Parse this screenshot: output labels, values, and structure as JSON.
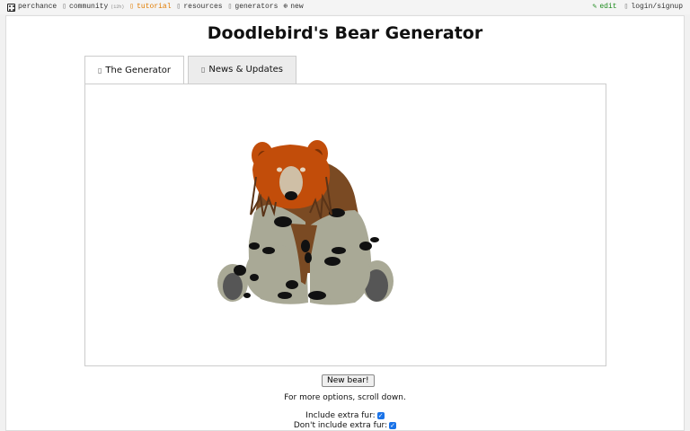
{
  "nav": {
    "brand": "perchance",
    "links": [
      {
        "label": "community",
        "count": "(12h)"
      },
      {
        "label": "tutorial"
      },
      {
        "label": "resources"
      },
      {
        "label": "generators"
      },
      {
        "label": "new"
      }
    ],
    "right": [
      {
        "label": "edit"
      },
      {
        "label": "login/signup"
      }
    ],
    "accent_active": "#e07b00",
    "accent_edit": "#1c8a1c"
  },
  "page": {
    "title": "Doodlebird's Bear Generator",
    "tabs": [
      {
        "label": "The Generator",
        "icon": "house-icon"
      },
      {
        "label": "News & Updates",
        "icon": "newspaper-icon"
      }
    ],
    "new_button": "New bear!",
    "hint": "For more options, scroll down.",
    "options": [
      {
        "label": "Include extra fur:",
        "checked": true
      },
      {
        "label": "Don't include extra fur:",
        "checked": true
      }
    ]
  },
  "bear_colors": {
    "head": "#c24d0a",
    "fur": "#7a4a23",
    "body": "#a9a996",
    "spots": "#111111",
    "paws": "#565656"
  }
}
